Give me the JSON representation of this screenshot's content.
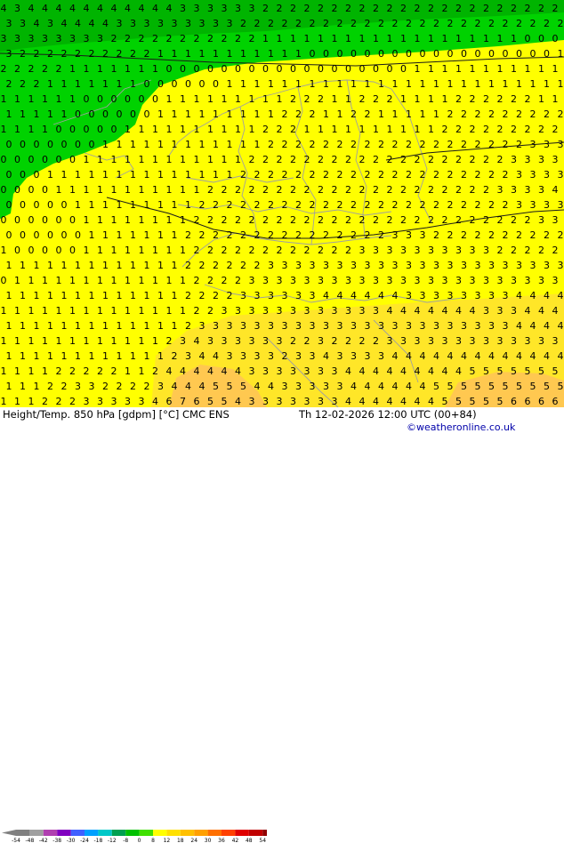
{
  "map": {
    "title_left": "Height/Temp. 850 hPa [gdpm] [°C] CMC ENS",
    "title_right": "Th 12-02-2026 12:00 UTC (00+84)",
    "credit": "©weatheronline.co.uk",
    "legend": {
      "ticks": [
        "-54",
        "-48",
        "-42",
        "-38",
        "-30",
        "-24",
        "-18",
        "-12",
        "-8",
        "0",
        "8",
        "12",
        "18",
        "24",
        "30",
        "36",
        "42",
        "48",
        "54"
      ],
      "colors": [
        "#808080",
        "#a0a0a0",
        "#b040b0",
        "#8000c0",
        "#4060ff",
        "#00a0ff",
        "#00c8c8",
        "#00a050",
        "#00c000",
        "#40e000",
        "#ffff00",
        "#ffe000",
        "#ffc000",
        "#ffa000",
        "#ff7000",
        "#ff4000",
        "#e00000",
        "#c00000",
        "#900000"
      ]
    },
    "colors": {
      "green_dark": "#00b400",
      "green": "#00d200",
      "yellow": "#ffff00",
      "yellow_orange": "#ffe628",
      "orange": "#ffc850",
      "label": "#000000",
      "border": "#a0a0a0"
    },
    "value_rows": [
      "4 3 4 4 4 4 4 4 4 4 4 4 4 3 3 3 3 3 3 2 2 2 2 2 2 2 2 2 2 2 2 2 2 2 2 2 2 2 2 2 2",
      "3 3 4 3 4 4 4 4 3 3 3 3 3 3 3 3 3 2 2 2 2 2 2 2 2 2 2 2 2 2 2 2 2 2 2 2 2 2 2 2 2",
      "3 3 3 3 3 3 3 3 2 2 2 2 2 2 2 2 2 2 2 1 1 1 1 1 1 1 1 1 1 1 1 1 1 1 1 1 1 1 0 0 0",
      "3 2 2 2 2 2 2 2 2 2 2 1 1 1 1 1 1 1 1 1 1 1 0 0 0 0 0 0 0 0 0 0 0 0 0 0 0 0 0 0 1",
      "2 2 2 2 2 1 1 1 1 1 1 1 0 0 0 0 0 0 0 0 0 0 0 0 0 0 0 0 0 0 1 1 1 1 1 1 1 1 1 1 1",
      "2 2 2 1 1 1 1 1 1 1 0 0 0 0 0 0 1 1 1 1 1 1 1 1 1 1 1 1 1 1 1 1 1 1 1 1 1 1 1 1 1",
      "1 1 1 1 1 1 0 0 0 0 0 0 1 1 1 1 1 1 1 1 1 2 2 2 1 1 2 2 2 1 1 1 1 2 2 2 2 2 2 1 1",
      "1 1 1 1 1 0 0 0 0 0 0 1 1 1 1 1 1 1 1 1 2 2 2 1 1 2 2 1 1 1 1 1 2 2 2 2 2 2 2 2 2",
      "1 1 1 1 0 0 0 0 0 1 1 1 1 1 1 1 1 1 1 2 2 2 1 1 1 1 1 1 1 1 1 1 2 2 2 2 2 2 2 2 2",
      "0 0 0 0 0 0 0 1 1 1 1 1 1 1 1 1 1 1 1 2 2 2 2 2 2 2 2 2 2 2 2 2 2 2 2 2 2 2 3 3 3",
      "0 0 0 0 0 0 1 1 1 1 1 1 1 1 1 1 1 1 2 2 2 2 2 2 2 2 2 2 2 2 2 2 2 2 2 2 2 3 3 3 3",
      "0 0 0 1 1 1 1 1 1 1 1 1 1 1 1 1 1 2 2 2 2 2 2 2 2 2 2 2 2 2 2 2 2 2 2 2 2 3 3 3 3",
      "0 0 0 0 1 1 1 1 1 1 1 1 1 1 1 2 2 2 2 2 2 2 2 2 2 2 2 2 2 2 2 2 2 2 2 2 3 3 3 3 4",
      "0 0 0 0 0 1 1 1 1 1 1 1 1 1 2 2 2 2 2 2 2 2 2 2 2 2 2 2 2 2 2 2 2 2 2 2 2 3 3 3 3",
      "0 0 0 0 0 0 1 1 1 1 1 1 1 1 2 2 2 2 2 2 2 2 2 2 2 2 2 2 2 2 2 2 2 2 2 2 2 2 2 3 3",
      "0 0 0 0 0 0 1 1 1 1 1 1 1 2 2 2 2 2 2 2 2 2 2 2 2 2 2 2 3 3 3 2 2 2 2 2 2 2 2 2 2",
      "1 0 0 0 0 0 1 1 1 1 1 1 1 1 2 2 2 2 2 2 2 2 2 2 2 2 3 3 3 3 3 3 3 3 3 3 2 2 2 2 2",
      "1 1 1 1 1 1 1 1 1 1 1 1 1 2 2 2 2 2 2 3 3 3 3 3 3 3 3 3 3 3 3 3 3 3 3 3 3 3 3 3 3",
      "0 1 1 1 1 1 1 1 1 1 1 1 1 1 2 2 2 2 3 3 3 3 3 3 3 3 3 3 3 3 3 3 3 3 3 3 3 3 3 3 3",
      "1 1 1 1 1 1 1 1 1 1 1 1 1 2 2 2 2 3 3 3 3 3 3 4 4 4 4 4 4 3 3 3 3 3 3 3 3 4 4 4 4",
      "1 1 1 1 1 1 1 1 1 1 1 1 1 1 2 2 3 3 3 3 3 3 3 3 3 3 3 3 4 4 4 4 4 4 4 3 3 3 4 4 4",
      "1 1 1 1 1 1 1 1 1 1 1 1 1 2 3 3 3 3 3 3 3 3 3 3 3 3 3 3 3 3 3 3 3 3 3 3 3 4 4 4 4",
      "1 1 1 1 1 1 1 1 1 1 1 1 2 3 4 3 3 3 3 3 3 2 2 3 2 2 2 2 3 3 3 3 3 3 3 3 3 3 3 3 3",
      "1 1 1 1 1 1 1 1 1 1 1 1 2 3 4 4 3 3 3 3 2 3 3 4 3 3 3 3 4 4 4 4 4 4 4 4 4 4 4 4 4",
      "1 1 1 1 2 2 2 2 2 1 1 2 4 4 4 4 4 4 3 3 3 3 3 3 3 4 4 4 4 4 4 4 4 4 5 5 5 5 5 5 5",
      "1 1 1 2 2 3 3 2 2 2 2 3 4 4 4 5 5 5 4 4 3 3 3 3 3 4 4 4 4 4 4 5 5 5 5 5 5 5 5 5 5",
      "1 1 1 2 2 2 3 3 3 3 3 4 6 7 6 5 5 4 3 3 3 3 3 3 3 4 4 4 4 4 4 4 5 5 5 5 5 6 6 6 6"
    ]
  }
}
